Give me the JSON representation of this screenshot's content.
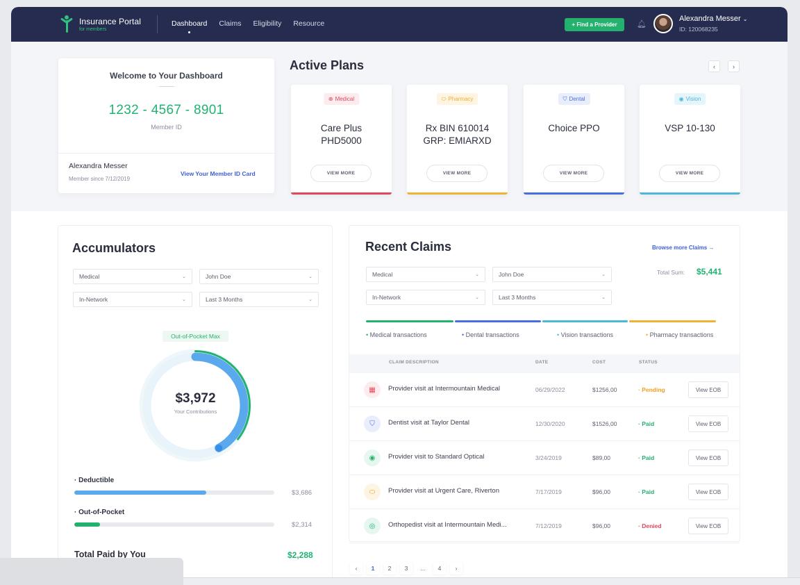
{
  "header": {
    "app_name": "Insurance Portal",
    "app_sub": "for members",
    "nav": [
      "Dashboard",
      "Claims",
      "Eligibility",
      "Resource"
    ],
    "active_nav": "Dashboard",
    "find_provider": "+ Find a Provider",
    "user_name": "Alexandra Messer",
    "user_id": "ID: 120068235"
  },
  "welcome": {
    "title": "Welcome to Your Dashboard",
    "member_id": "1232 - 4567 - 8901",
    "member_id_label": "Member ID",
    "name": "Alexandra Messer",
    "since": "Member since 7/12/2019",
    "card_link": "View Your Member ID Card"
  },
  "plans": {
    "title": "Active Plans",
    "prev": "‹",
    "next": "›",
    "items": [
      {
        "badge": "Medical",
        "icon": "plus-icon",
        "name_line1": "Care Plus",
        "name_line2": "PHD5000",
        "button": "VIEW MORE",
        "color": "#e0485a",
        "badge_bg": "#fdeced"
      },
      {
        "badge": "Pharmacy",
        "icon": "pill-icon",
        "name_line1": "Rx BIN 610014",
        "name_line2": "GRP: EMIARXD",
        "button": "VIEW MORE",
        "color": "#f0b232",
        "badge_bg": "#fdf4e1"
      },
      {
        "badge": "Dental",
        "icon": "tooth-icon",
        "name_line1": "Choice PPO",
        "name_line2": "",
        "button": "VIEW MORE",
        "color": "#4a6ee0",
        "badge_bg": "#e9eefc"
      },
      {
        "badge": "Vision",
        "icon": "eye-icon",
        "name_line1": "VSP 10-130",
        "name_line2": "",
        "button": "VIEW MORE",
        "color": "#4ab8d6",
        "badge_bg": "#e6f5fa"
      }
    ]
  },
  "accumulators": {
    "title": "Accumulators",
    "filters": [
      "Medical",
      "John Doe",
      "In-Network",
      "Last 3 Months"
    ],
    "oop_label": "Out-of-Pocket Max",
    "amount": "$3,972",
    "amount_label": "Your Contributions",
    "donut_fraction": 0.42,
    "deductible_label": "Deductible",
    "deductible_value": "$3,686",
    "deductible_fraction": 0.66,
    "oop_bar_label": "Out-of-Pocket",
    "oop_bar_value": "$2,314",
    "oop_bar_fraction": 0.13,
    "total_label": "Total Paid by You",
    "total_value": "$2,288"
  },
  "claims": {
    "title": "Recent Claims",
    "browse": "Browse more Claims →",
    "filters": [
      "Medical",
      "John Doe",
      "In-Network",
      "Last 3 Months"
    ],
    "total_label": "Total Sum:",
    "total_value": "$5,441",
    "legend": [
      "Medical transactions",
      "Dental transactions",
      "Vision transactions",
      "Pharmacy transactions"
    ],
    "legend_colors": [
      "#23b26d",
      "#4a6ee0",
      "#4ab8d6",
      "#f0b232"
    ],
    "columns": [
      "CLAIM DESCRIPTION",
      "DATE",
      "COST",
      "STATUS"
    ],
    "rows": [
      {
        "icon": "hospital-icon",
        "desc": "Provider visit at Intermountain Medical",
        "date": "06/29/2022",
        "cost": "$1256,00",
        "status": "Pending",
        "button": "View EOB"
      },
      {
        "icon": "tooth-icon",
        "desc": "Dentist visit at Taylor Dental",
        "date": "12/30/2020",
        "cost": "$1526,00",
        "status": "Paid",
        "button": "View EOB"
      },
      {
        "icon": "eye-icon",
        "desc": "Provider visit to Standard Optical",
        "date": "3/24/2019",
        "cost": "$89,00",
        "status": "Paid",
        "button": "View EOB"
      },
      {
        "icon": "pill-icon",
        "desc": "Provider visit at Urgent Care, Riverton",
        "date": "7/17/2019",
        "cost": "$96,00",
        "status": "Paid",
        "button": "View EOB"
      },
      {
        "icon": "target-icon",
        "desc": "Orthopedist visit at Intermountain Medi...",
        "date": "7/12/2019",
        "cost": "$96,00",
        "status": "Denied",
        "button": "View EOB"
      }
    ],
    "status_colors": {
      "Pending": "#f0a020",
      "Paid": "#23b26d",
      "Denied": "#e0485a"
    }
  },
  "pagination": [
    "‹",
    "1",
    "2",
    "3",
    "...",
    "4",
    "›"
  ]
}
